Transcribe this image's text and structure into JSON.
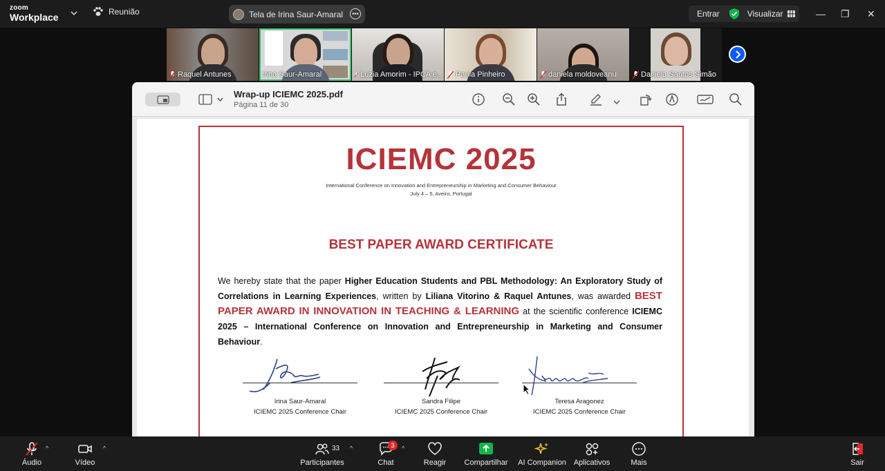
{
  "app": {
    "logo_top": "zoom",
    "logo_bottom": "Workplace",
    "meeting_label": "Reunião"
  },
  "share": {
    "label": "Tela de Irina Saur-Amaral"
  },
  "topright": {
    "entrar": "Entrar",
    "visualizar": "Visualizar"
  },
  "window_controls": {
    "minimize": "—",
    "restore": "❐",
    "close": "✕"
  },
  "participants": [
    {
      "name": "Raquel Antunes",
      "muted": true,
      "active": false
    },
    {
      "name": "Irina Saur-Amaral",
      "muted": false,
      "active": true
    },
    {
      "name": "Luzia Amorim - IPCA e...",
      "muted": true,
      "active": false
    },
    {
      "name": "Paula Pinheiro",
      "muted": true,
      "active": false
    },
    {
      "name": "daniela moldoveanu",
      "muted": true,
      "active": false
    },
    {
      "name": "Daniela Santos Simão",
      "muted": true,
      "active": false
    }
  ],
  "pdf": {
    "title": "Wrap-up ICIEMC 2025.pdf",
    "page": "Página 11 de 30"
  },
  "certificate": {
    "title": "ICIEMC 2025",
    "conference": "International Conference on Innovation and Entrepreneurship in Marketing and Consumer Behaviour",
    "date_place": "July 4 – 5, Aveiro, Portugal",
    "award_heading": "BEST PAPER AWARD CERTIFICATE",
    "body_1": "We hereby state that the paper ",
    "paper_title": "Higher Education Students and PBL Methodology: An Exploratory Study of Correlations in Learning Experiences",
    "body_2": ", written by ",
    "authors": "Liliana Vitorino & Raquel Antunes",
    "body_3": ", was awarded ",
    "award_name": "BEST PAPER AWARD IN INNOVATION IN TEACHING & LEARNING",
    "body_4": " at the scientific conference ",
    "conference_full": "ICIEMC 2025 – International Conference on Innovation and Entrepreneurship in Marketing and Consumer Behaviour",
    "body_5": ".",
    "signatories": [
      {
        "name": "Irina Saur-Amaral",
        "role": "ICIEMC 2025 Conference Chair"
      },
      {
        "name": "Sandra Filipe",
        "role": "ICIEMC 2025 Conference Chair"
      },
      {
        "name": "Teresa Aragonez",
        "role": "ICIEMC 2025 Conference Chair"
      }
    ]
  },
  "toolbar": {
    "audio": "Áudio",
    "video": "Vídeo",
    "participants": "Participantes",
    "participants_count": "33",
    "chat": "Chat",
    "chat_badge": "3",
    "react": "Reagir",
    "share": "Compartilhar",
    "ai": "AI Companion",
    "apps": "Aplicativos",
    "more": "Mais",
    "leave": "Sair"
  },
  "colors": {
    "accent_blue": "#0b5cff",
    "share_green": "#12b549",
    "cert_red": "#b5333a",
    "active_tile": "#34c36b"
  }
}
